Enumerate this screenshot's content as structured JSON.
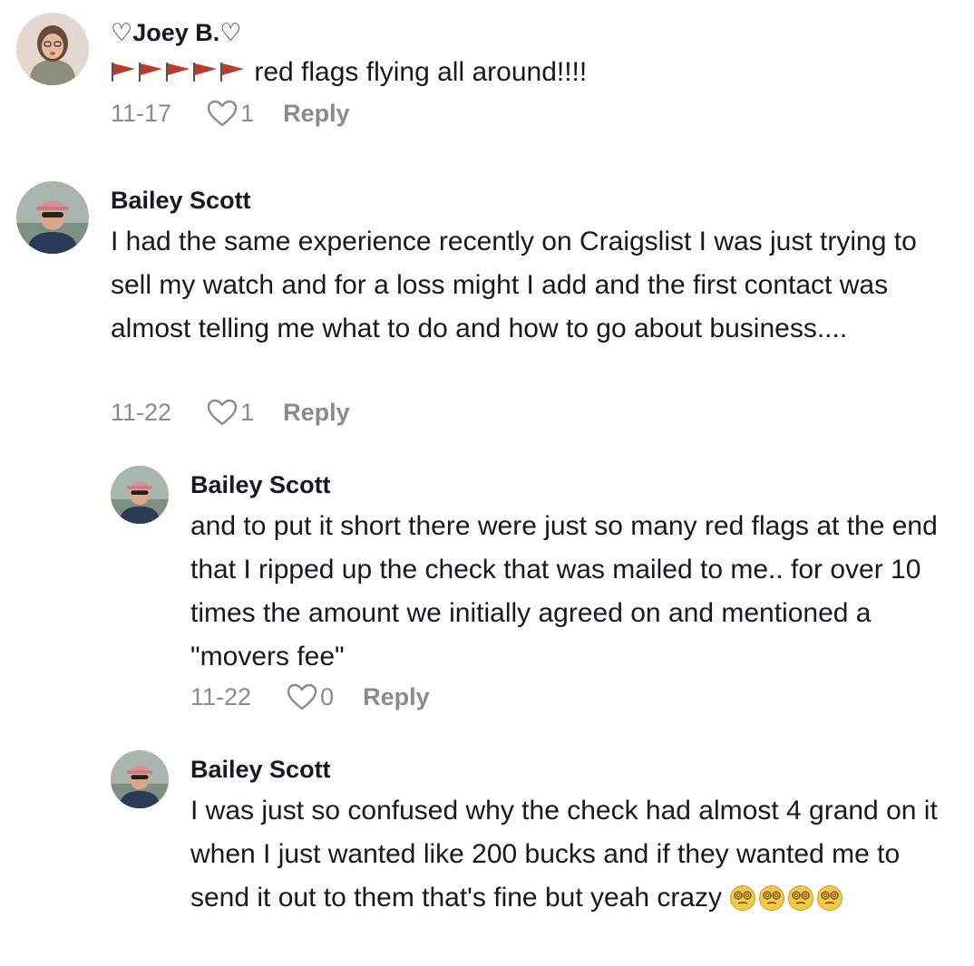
{
  "comments": [
    {
      "username": "♡Joey B.♡",
      "flag_emoji_count": 5,
      "text": "red flags flying all around!!!!",
      "date": "11-17",
      "likes": "1",
      "reply_label": "Reply"
    },
    {
      "username": "Bailey Scott",
      "text": "I had the same experience recently on Craigslist I was just trying to sell my watch and for a loss might I add and the first contact was almost telling me what to do and how to go about business....",
      "date": "11-22",
      "likes": "1",
      "reply_label": "Reply"
    },
    {
      "username": "Bailey Scott",
      "text": "and to put it short there were just so many red flags at the end that I ripped up the check that was mailed to me.. for over 10 times the amount we initially agreed on and mentioned a \"movers fee\"",
      "date": "11-22",
      "likes": "0",
      "reply_label": "Reply"
    },
    {
      "username": "Bailey Scott",
      "text": "I was just so confused why the check had almost 4 grand on it when I just wanted like 200 bucks and if they wanted me to send it out to them that's fine but yeah crazy",
      "dizzy_emoji_count": 4,
      "date": "",
      "likes": "",
      "reply_label": ""
    }
  ],
  "colors": {
    "text": "#161823",
    "meta": "#8a8b91",
    "flag": "#c0392b",
    "emoji_face": "#f7c948"
  },
  "icons": {
    "like": "heart-outline-icon",
    "flag": "red-flag-icon",
    "emoji": "dizzy-face-icon"
  }
}
